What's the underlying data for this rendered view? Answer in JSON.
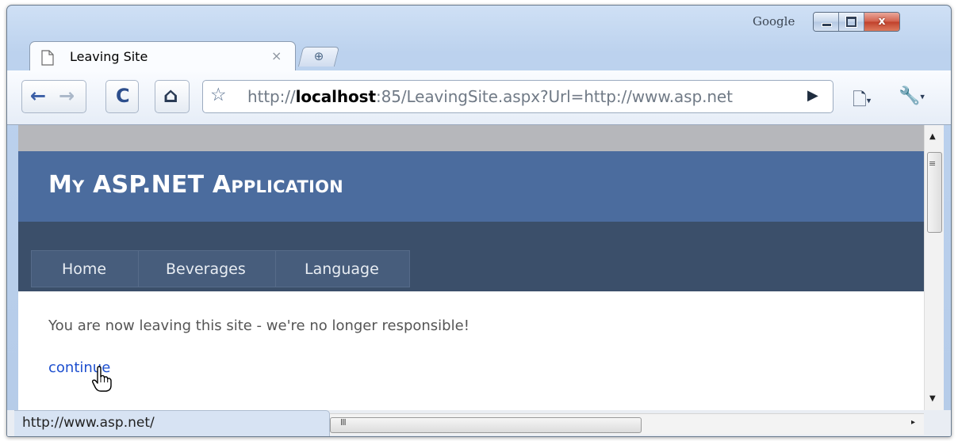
{
  "window": {
    "brand": "Google",
    "controls": {
      "minimize": "minimize",
      "maximize": "maximize",
      "close": "x"
    }
  },
  "tab": {
    "icon": "page-icon",
    "title": "Leaving Site",
    "close_glyph": "×",
    "new_tab_glyph": "⊕"
  },
  "toolbar": {
    "back_glyph": "←",
    "forward_glyph": "→",
    "reload_glyph": "C",
    "home_glyph": "⌂",
    "star_glyph": "☆",
    "url_prefix": "http://",
    "url_host": "localhost",
    "url_rest": ":85/LeavingSite.aspx?Url=http://www.asp.net",
    "go_glyph": "▶",
    "page_menu_glyph": "🗋",
    "tools_menu_glyph": "🔧",
    "dropdown_glyph": "▾"
  },
  "page": {
    "app_title": "My ASP.NET Application",
    "menu": [
      "Home",
      "Beverages",
      "Language"
    ],
    "message": "You are now leaving this site - we're no longer responsible!",
    "link_text": "continue",
    "colors": {
      "header": "#4b6c9e",
      "menubar": "#3b4f6a",
      "link": "#1d4fcf"
    }
  },
  "scrollbars": {
    "up": "▲",
    "down": "▼",
    "right": "▸",
    "grip_v": "≡",
    "grip_h": "III"
  },
  "status_bar": {
    "text": "http://www.asp.net/"
  }
}
